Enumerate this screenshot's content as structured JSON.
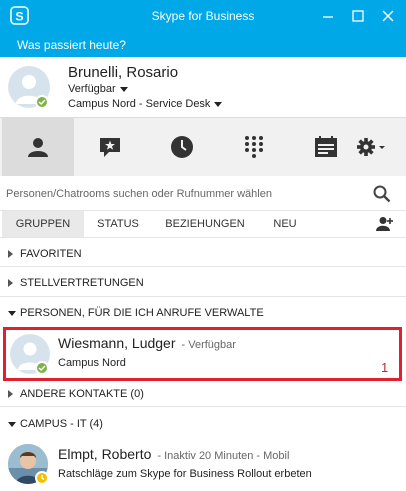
{
  "window": {
    "title": "Skype for Business"
  },
  "whats_happening": {
    "placeholder": "Was passiert heute?"
  },
  "me": {
    "name": "Brunelli, Rosario",
    "availability": "Verfügbar",
    "location": "Campus Nord - Service Desk",
    "status_color": "#7cb342"
  },
  "nav": {
    "tabs": [
      {
        "icon": "contacts-icon",
        "active": true
      },
      {
        "icon": "chat-star-icon",
        "active": false
      },
      {
        "icon": "clock-icon",
        "active": false
      },
      {
        "icon": "dialpad-icon",
        "active": false
      },
      {
        "icon": "meetings-icon",
        "active": false
      },
      {
        "icon": "gear-icon",
        "active": false
      }
    ]
  },
  "search": {
    "placeholder": "Personen/Chatrooms suchen oder Rufnummer wählen"
  },
  "filters": {
    "groups": "GRUPPEN",
    "status": "STATUS",
    "relations": "BEZIEHUNGEN",
    "new": "NEU"
  },
  "groups": {
    "favorites": "FAVORITEN",
    "delegates": "STELLVERTRETUNGEN",
    "managed": "PERSONEN, FÜR DIE ICH ANRUFE VERWALTE",
    "other": "ANDERE KONTAKTE (0)",
    "campus": "CAMPUS - IT (4)"
  },
  "contacts": {
    "wiesmann": {
      "name": "Wiesmann, Ludger",
      "status": "- Verfügbar",
      "location": "Campus Nord",
      "badge": "1",
      "status_color": "#7cb342"
    },
    "elmpt": {
      "name": "Elmpt, Roberto",
      "status": "- Inaktiv 20 Minuten - Mobil",
      "note": "Ratschläge zum Skype for Business Rollout erbeten",
      "status_color": "#f2c200"
    }
  },
  "colors": {
    "brand": "#00a8e8",
    "highlight": "#e0202e"
  }
}
